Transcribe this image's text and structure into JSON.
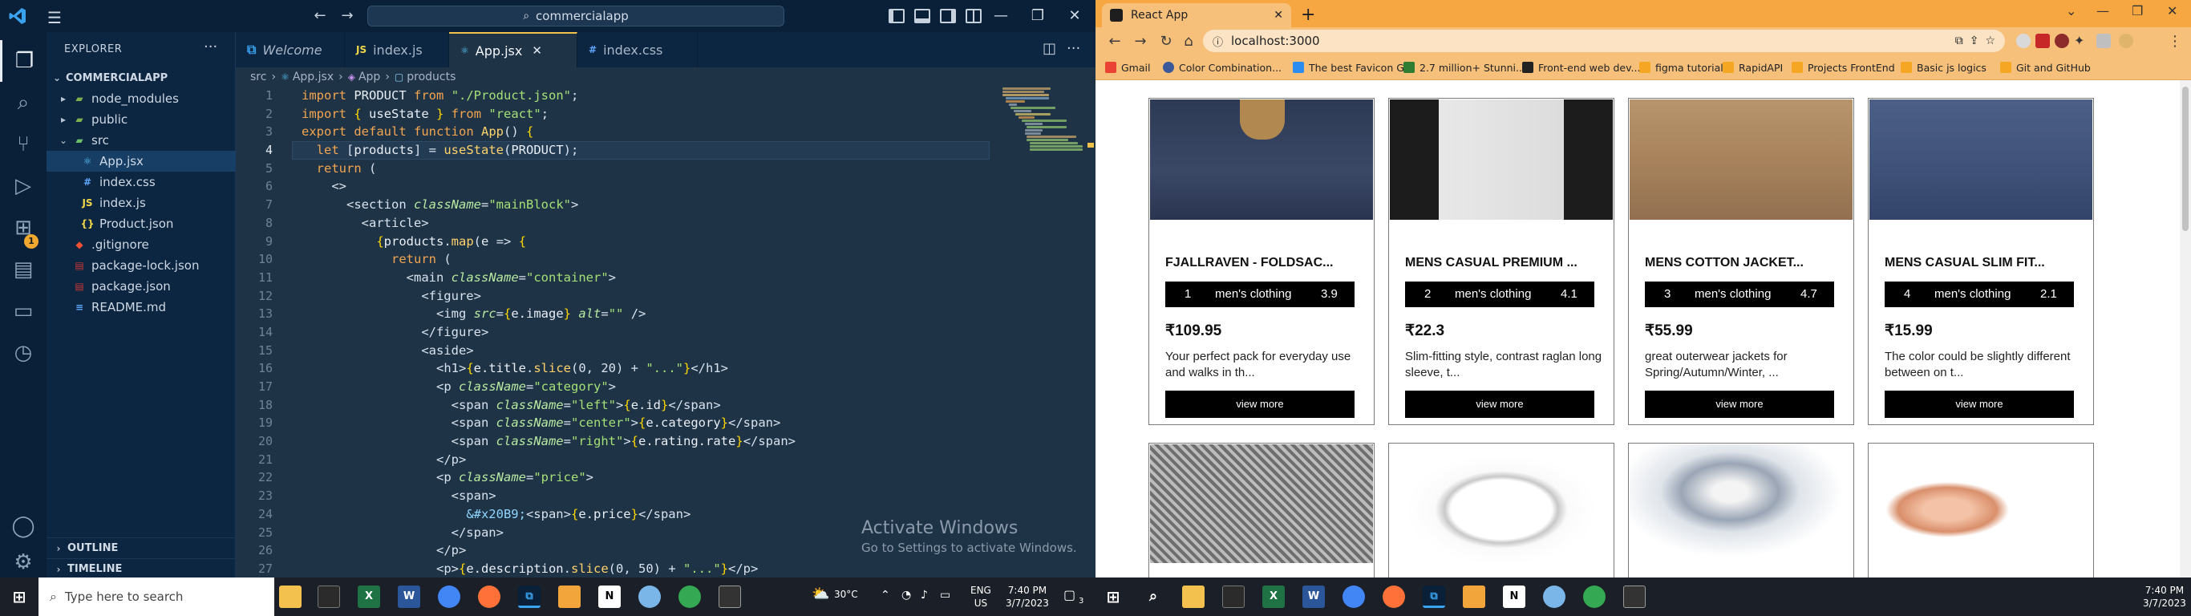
{
  "vscode": {
    "title_search": "commercialapp",
    "sidebar": {
      "title": "EXPLORER",
      "project": "COMMERCIALAPP",
      "tree": [
        {
          "label": "node_modules",
          "kind": "folder",
          "level": 1
        },
        {
          "label": "public",
          "kind": "folder",
          "level": 1
        },
        {
          "label": "src",
          "kind": "folder-open",
          "level": 1
        },
        {
          "label": "App.jsx",
          "kind": "jsx",
          "level": 2
        },
        {
          "label": "index.css",
          "kind": "css",
          "level": 2
        },
        {
          "label": "index.js",
          "kind": "js",
          "level": 2
        },
        {
          "label": "Product.json",
          "kind": "json",
          "level": 2
        },
        {
          "label": ".gitignore",
          "kind": "git",
          "level": 1
        },
        {
          "label": "package-lock.json",
          "kind": "npm",
          "level": 1
        },
        {
          "label": "package.json",
          "kind": "npm",
          "level": 1
        },
        {
          "label": "README.md",
          "kind": "md",
          "level": 1
        }
      ],
      "outline": "OUTLINE",
      "timeline": "TIMELINE"
    },
    "activity_badge": "1",
    "tabs": [
      {
        "label": "Welcome",
        "icon": "vscode-icon"
      },
      {
        "label": "index.js",
        "icon": "JS"
      },
      {
        "label": "App.jsx",
        "icon": "JSX",
        "active": true
      },
      {
        "label": "index.css",
        "icon": "CSS"
      }
    ],
    "breadcrumb": [
      "src",
      "App.jsx",
      "App",
      "products"
    ],
    "line_numbers": [
      "1",
      "2",
      "3",
      "4",
      "5",
      "6",
      "7",
      "8",
      "9",
      "10",
      "11",
      "12",
      "13",
      "14",
      "15",
      "16",
      "17",
      "18",
      "19",
      "20",
      "21",
      "22",
      "23",
      "24",
      "25",
      "26",
      "27"
    ],
    "watermark_title": "Activate Windows",
    "watermark_sub": "Go to Settings to activate Windows."
  },
  "chrome": {
    "tab_title": "React App",
    "url": "localhost:3000",
    "bookmarks": [
      "Gmail",
      "Color Combination...",
      "The best Favicon G...",
      "2.7 million+ Stunni...",
      "Front-end web dev...",
      "figma tutorial",
      "RapidAPI",
      "Projects FrontEnd",
      "Basic js logics",
      "Git and GitHub"
    ],
    "products": [
      {
        "id": "1",
        "title": "FJALLRAVEN - FOLDSAC...",
        "category": "men's clothing",
        "rating": "3.9",
        "price": "₹109.95",
        "desc": "Your perfect pack for everyday use and walks in th...",
        "button": "view more"
      },
      {
        "id": "2",
        "title": "MENS CASUAL PREMIUM ...",
        "category": "men's clothing",
        "rating": "4.1",
        "price": "₹22.3",
        "desc": "Slim-fitting style, contrast raglan long sleeve, t...",
        "button": "view more"
      },
      {
        "id": "3",
        "title": "MENS COTTON JACKET...",
        "category": "men's clothing",
        "rating": "4.7",
        "price": "₹55.99",
        "desc": "great outerwear jackets for Spring/Autumn/Winter, ...",
        "button": "view more"
      },
      {
        "id": "4",
        "title": "MENS CASUAL SLIM FIT...",
        "category": "men's clothing",
        "rating": "2.1",
        "price": "₹15.99",
        "desc": "The color could be slightly different between on t...",
        "button": "view more"
      }
    ]
  },
  "taskbar_left": {
    "search_placeholder": "Type here to search",
    "weather": "30°C",
    "lang1": "ENG",
    "lang2": "US",
    "time": "7:40 PM",
    "date": "3/7/2023",
    "notif": "3"
  },
  "taskbar_right": {
    "time": "7:40 PM",
    "date": "3/7/2023"
  }
}
